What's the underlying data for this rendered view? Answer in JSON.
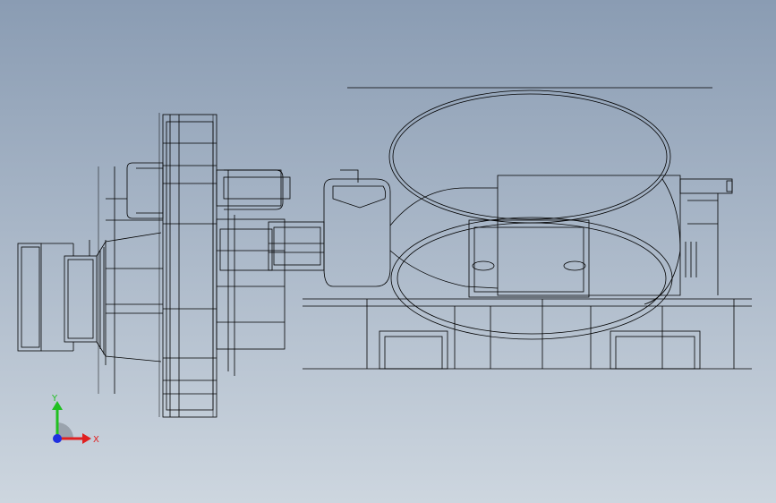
{
  "triad": {
    "x_label": "X",
    "y_label": "Y",
    "colors": {
      "x": "#e02020",
      "y": "#20c020",
      "z": "#2030e0"
    }
  },
  "viewport": {
    "background_top": "#8a9cb3",
    "background_bottom": "#cdd6df",
    "line_color": "#000000"
  }
}
